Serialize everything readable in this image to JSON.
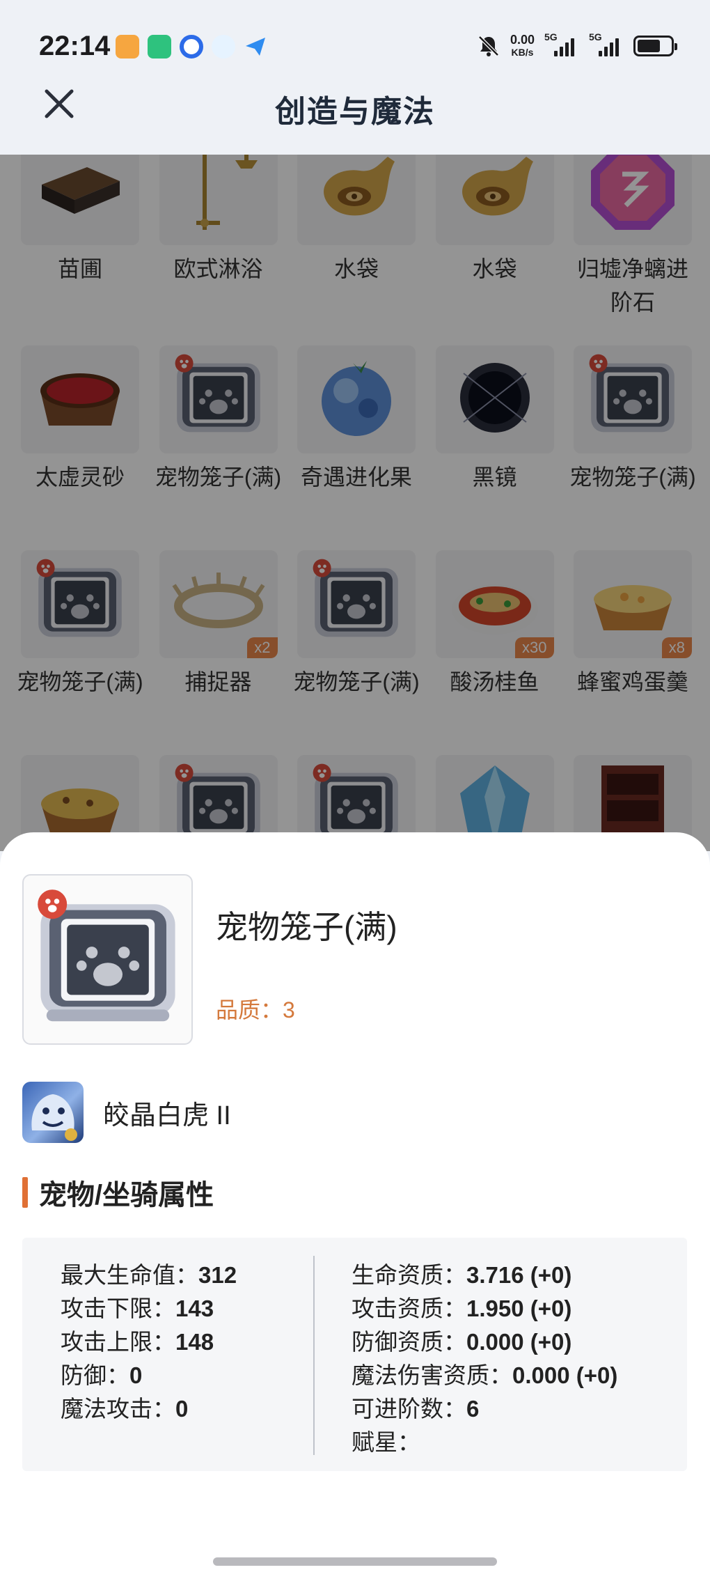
{
  "status_bar": {
    "time": "22:14",
    "net_speed_value": "0.00",
    "net_speed_unit": "KB/s",
    "signal1_label": "5G",
    "signal2_label": "5G"
  },
  "header": {
    "title": "创造与魔法",
    "close_icon": "close-icon"
  },
  "grid": {
    "items": [
      {
        "name": "苗圃",
        "icon": "nursery-icon",
        "qty": ""
      },
      {
        "name": "欧式淋浴",
        "icon": "shower-icon",
        "qty": ""
      },
      {
        "name": "水袋",
        "icon": "waterbag-icon",
        "qty": ""
      },
      {
        "name": "水袋",
        "icon": "waterbag-icon",
        "qty": ""
      },
      {
        "name": "归墟净螭进阶石",
        "icon": "gem-icon",
        "qty": ""
      },
      {
        "name": "太虚灵砂",
        "icon": "sand-bowl-icon",
        "qty": ""
      },
      {
        "name": "宠物笼子(满)",
        "icon": "pet-cage-icon",
        "qty": ""
      },
      {
        "name": "奇遇进化果",
        "icon": "fruit-icon",
        "qty": ""
      },
      {
        "name": "黑镜",
        "icon": "black-mirror-icon",
        "qty": ""
      },
      {
        "name": "宠物笼子(满)",
        "icon": "pet-cage-icon",
        "qty": ""
      },
      {
        "name": "宠物笼子(满)",
        "icon": "pet-cage-icon",
        "qty": ""
      },
      {
        "name": "捕捉器",
        "icon": "catcher-icon",
        "qty": "x2"
      },
      {
        "name": "宠物笼子(满)",
        "icon": "pet-cage-icon",
        "qty": ""
      },
      {
        "name": "酸汤桂鱼",
        "icon": "fish-dish-icon",
        "qty": "x30"
      },
      {
        "name": "蜂蜜鸡蛋羹",
        "icon": "custard-icon",
        "qty": "x8"
      },
      {
        "name": "",
        "icon": "rice-bowl-icon",
        "qty": ""
      },
      {
        "name": "",
        "icon": "pet-cage-icon",
        "qty": ""
      },
      {
        "name": "",
        "icon": "pet-cage-icon",
        "qty": ""
      },
      {
        "name": "",
        "icon": "crystal-icon",
        "qty": ""
      },
      {
        "name": "",
        "icon": "cabinet-icon",
        "qty": ""
      }
    ]
  },
  "detail": {
    "name": "宠物笼子(满)",
    "quality": "品质：3",
    "pet_name": "皎晶白虎 II",
    "section_title": "宠物/坐骑属性",
    "left_attrs": [
      {
        "label": "最大生命值：",
        "value": "312"
      },
      {
        "label": "攻击下限：",
        "value": "143"
      },
      {
        "label": "攻击上限：",
        "value": "148"
      },
      {
        "label": "防御：",
        "value": "0"
      },
      {
        "label": "魔法攻击：",
        "value": "0"
      }
    ],
    "right_attrs": [
      {
        "label": "生命资质：",
        "value": "3.716 (+0)"
      },
      {
        "label": "攻击资质：",
        "value": "1.950 (+0)"
      },
      {
        "label": "防御资质：",
        "value": "0.000 (+0)"
      },
      {
        "label": "魔法伤害资质：",
        "value": "0.000 (+0)"
      },
      {
        "label": "可进阶数：",
        "value": "6"
      },
      {
        "label": "赋星：",
        "value": ""
      }
    ]
  },
  "colors": {
    "accent": "#e07035",
    "quality": "#d4793c"
  }
}
